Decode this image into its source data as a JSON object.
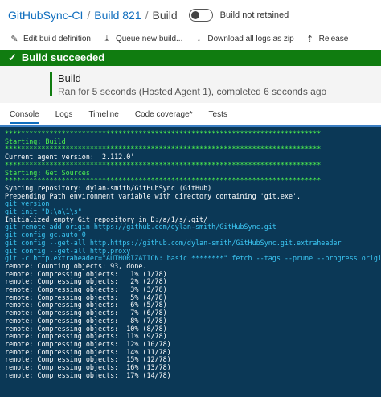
{
  "breadcrumb": {
    "items": [
      "GitHubSync-CI",
      "Build 821"
    ],
    "current": "Build",
    "separator": "/"
  },
  "retention": {
    "label": "Build not retained",
    "checked": false
  },
  "toolbar": {
    "edit": {
      "label": "Edit build definition",
      "icon": "pencil-icon"
    },
    "queue": {
      "label": "Queue new build...",
      "icon": "queue-icon"
    },
    "download": {
      "label": "Download all logs as zip",
      "icon": "download-icon"
    },
    "release": {
      "label": "Release",
      "icon": "release-icon"
    }
  },
  "status": {
    "text": "Build succeeded",
    "color": "#107c10"
  },
  "build_info": {
    "title": "Build",
    "subtitle": "Ran for 5 seconds (Hosted Agent 1), completed 6 seconds ago"
  },
  "tabs": [
    "Console",
    "Logs",
    "Timeline",
    "Code coverage*",
    "Tests"
  ],
  "active_tab": "Console",
  "console": {
    "lines": [
      {
        "text": "******************************************************************************",
        "kind": "green"
      },
      {
        "text": "Starting: Build",
        "kind": "green"
      },
      {
        "text": "******************************************************************************",
        "kind": "green"
      },
      {
        "text": "Current agent version: '2.112.0'",
        "kind": "white"
      },
      {
        "text": "******************************************************************************",
        "kind": "green"
      },
      {
        "text": "Starting: Get Sources",
        "kind": "green"
      },
      {
        "text": "******************************************************************************",
        "kind": "green"
      },
      {
        "text": "Syncing repository: dylan-smith/GitHubSync (GitHub)",
        "kind": "white"
      },
      {
        "text": "Prepending Path environment variable with directory containing 'git.exe'.",
        "kind": "white"
      },
      {
        "text": "git version",
        "kind": "cyan"
      },
      {
        "text": "git init \"D:\\a\\1\\s\"",
        "kind": "cyan"
      },
      {
        "text": "Initialized empty Git repository in D:/a/1/s/.git/",
        "kind": "white"
      },
      {
        "text": "git remote add origin https://github.com/dylan-smith/GitHubSync.git",
        "kind": "cyan"
      },
      {
        "text": "git config gc.auto 0",
        "kind": "cyan"
      },
      {
        "text": "git config --get-all http.https://github.com/dylan-smith/GitHubSync.git.extraheader",
        "kind": "cyan"
      },
      {
        "text": "git config --get-all http.proxy",
        "kind": "cyan"
      },
      {
        "text": "git -c http.extraheader=\"AUTHORIZATION: basic ********\" fetch --tags --prune --progress origin",
        "kind": "cyan"
      },
      {
        "text": "remote: Counting objects: 93, done.",
        "kind": "white"
      },
      {
        "text": "remote: Compressing objects:   1% (1/78)",
        "kind": "white"
      },
      {
        "text": "remote: Compressing objects:   2% (2/78)",
        "kind": "white"
      },
      {
        "text": "remote: Compressing objects:   3% (3/78)",
        "kind": "white"
      },
      {
        "text": "remote: Compressing objects:   5% (4/78)",
        "kind": "white"
      },
      {
        "text": "remote: Compressing objects:   6% (5/78)",
        "kind": "white"
      },
      {
        "text": "remote: Compressing objects:   7% (6/78)",
        "kind": "white"
      },
      {
        "text": "remote: Compressing objects:   8% (7/78)",
        "kind": "white"
      },
      {
        "text": "remote: Compressing objects:  10% (8/78)",
        "kind": "white"
      },
      {
        "text": "remote: Compressing objects:  11% (9/78)",
        "kind": "white"
      },
      {
        "text": "remote: Compressing objects:  12% (10/78)",
        "kind": "white"
      },
      {
        "text": "remote: Compressing objects:  14% (11/78)",
        "kind": "white"
      },
      {
        "text": "remote: Compressing objects:  15% (12/78)",
        "kind": "white"
      },
      {
        "text": "remote: Compressing objects:  16% (13/78)",
        "kind": "white"
      },
      {
        "text": "remote: Compressing objects:  17% (14/78)",
        "kind": "white"
      }
    ]
  }
}
